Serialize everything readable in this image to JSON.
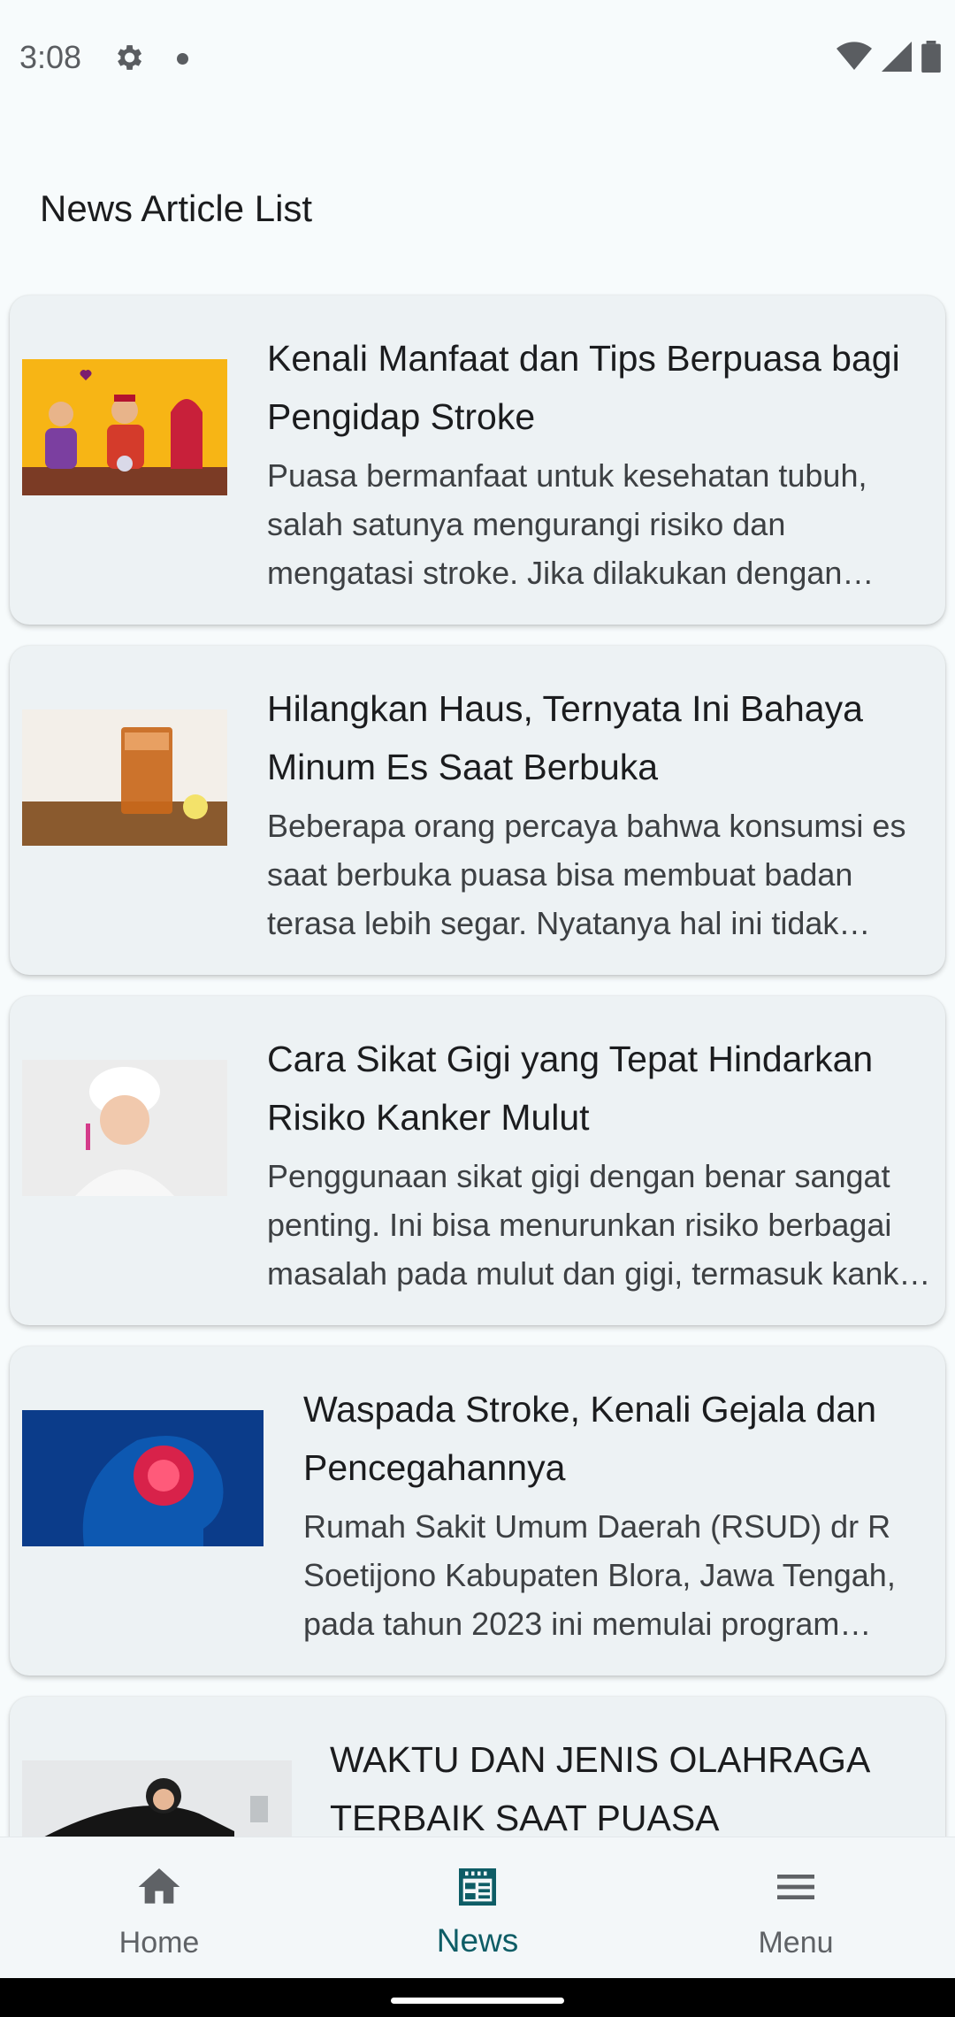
{
  "status_bar": {
    "time": "3:08"
  },
  "page_title": "News Article List",
  "articles": [
    {
      "title": "Kenali Manfaat dan Tips Berpuasa bagi Pengidap Stroke",
      "description": "Puasa bermanfaat untuk kesehatan tubuh, salah satunya mengurangi risiko dan mengatasi stroke. Jika dilakukan dengan benar dan teratur, puasa dapat membantu menjaga kesehatan."
    },
    {
      "title": "Hilangkan Haus, Ternyata Ini Bahaya Minum Es Saat Berbuka",
      "description": "Beberapa orang percaya bahwa konsumsi es saat berbuka puasa bisa membuat badan terasa lebih segar. Nyatanya hal ini tidak sepenuhnya benar."
    },
    {
      "title": "Cara Sikat Gigi yang Tepat Hindarkan Risiko Kanker Mulut",
      "description": "Penggunaan sikat gigi dengan benar sangat penting. Ini bisa menurunkan risiko berbagai masalah pada mulut dan gigi, termasuk kanker mulut."
    },
    {
      "title": "Waspada Stroke, Kenali Gejala dan Pencegahannya",
      "description": "Rumah Sakit Umum Daerah (RSUD) dr R Soetijono Kabupaten Blora, Jawa Tengah, pada tahun 2023 ini memulai program pencegahan stroke."
    },
    {
      "title": "WAKTU DAN JENIS OLAHRAGA TERBAIK SAAT PUASA",
      "description": ""
    }
  ],
  "bottom_nav": [
    {
      "label": "Home",
      "icon": "home-icon"
    },
    {
      "label": "News",
      "icon": "news-icon",
      "active": true
    },
    {
      "label": "Menu",
      "icon": "menu-icon"
    }
  ],
  "colors": {
    "accent": "#0e5d66",
    "card": "#edf2f4",
    "background": "#f7fbfc"
  }
}
